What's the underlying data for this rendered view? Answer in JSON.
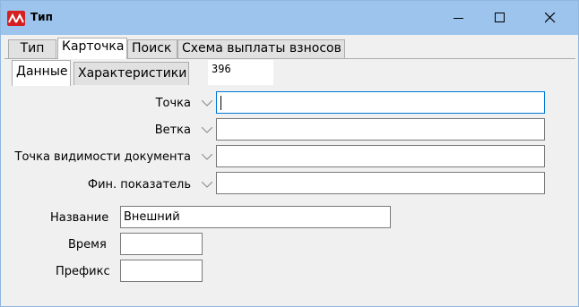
{
  "window": {
    "title": "Тип",
    "app_icon": "app-logo-icon",
    "buttons": [
      "minimize-icon",
      "maximize-icon",
      "close-icon"
    ]
  },
  "tabs": [
    {
      "label": "Тип",
      "active": false
    },
    {
      "label": "Карточка",
      "active": true
    },
    {
      "label": "Поиск",
      "active": false
    },
    {
      "label": "Схема выплаты взносов",
      "active": false
    }
  ],
  "subtabs": [
    {
      "label": "Данные",
      "active": true
    },
    {
      "label": "Характеристики",
      "active": false
    }
  ],
  "record_id": "396",
  "fields": {
    "tochka": {
      "label": "Точка",
      "value": ""
    },
    "vetka": {
      "label": "Ветка",
      "value": ""
    },
    "tochka_vid": {
      "label": "Точка видимости документа",
      "value": ""
    },
    "fin": {
      "label": "Фин. показатель",
      "value": ""
    },
    "name": {
      "label": "Название",
      "value": "Внешний"
    },
    "time": {
      "label": "Время",
      "value": ""
    },
    "prefix": {
      "label": "Префикс",
      "value": ""
    }
  },
  "colors": {
    "titlebar": "#9dc4ec",
    "window_bg": "#f0f0f0",
    "focus_border": "#0078d7",
    "app_icon": "#d42020"
  }
}
